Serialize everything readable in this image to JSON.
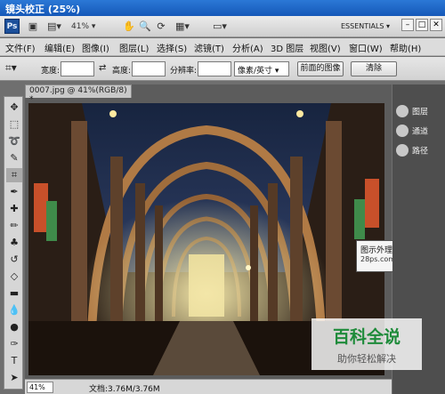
{
  "title": "镜头校正 (25%)",
  "appbar": {
    "logo": "Ps",
    "zoom": "41%",
    "workspace": "ESSENTIALS ▾"
  },
  "menu": [
    "文件(F)",
    "编辑(E)",
    "图像(I)",
    "图层(L)",
    "选择(S)",
    "滤镜(T)",
    "分析(A)",
    "3D 图层",
    "视图(V)",
    "窗口(W)",
    "帮助(H)"
  ],
  "options": {
    "width_label": "宽度:",
    "height_label": "高度:",
    "resolution_label": "分辨率:",
    "unit": "像素/英寸",
    "front_image": "前面的图像",
    "clear": "清除"
  },
  "document": {
    "tab": "0007.jpg @ 41%(RGB/8) *",
    "zoom": "41%",
    "doc_size": "文档:3.76M/3.76M"
  },
  "panels": [
    "图层",
    "通道",
    "路径"
  ],
  "tooltip": {
    "line1": "图示外理",
    "line2": "28ps.com",
    "line3": "网"
  },
  "watermark": {
    "title": "百科全说",
    "subtitle": "助你轻松解决"
  },
  "colors": {
    "titlebar": "#1f66c8",
    "watermark_green": "#1e8b3a"
  }
}
